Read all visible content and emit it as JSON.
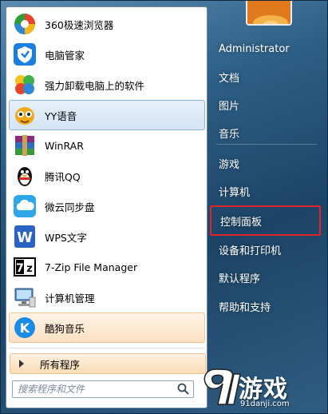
{
  "programs": [
    {
      "label": "360极速浏览器",
      "icon": "360-chrome-icon",
      "state": "normal"
    },
    {
      "label": "电脑管家",
      "icon": "pc-manager-icon",
      "state": "normal"
    },
    {
      "label": "强力卸载电脑上的软件",
      "icon": "uninstall-icon",
      "state": "normal"
    },
    {
      "label": "YY语音",
      "icon": "yy-voice-icon",
      "state": "hover"
    },
    {
      "label": "WinRAR",
      "icon": "winrar-icon",
      "state": "normal"
    },
    {
      "label": "腾讯QQ",
      "icon": "qq-penguin-icon",
      "state": "normal"
    },
    {
      "label": "微云同步盘",
      "icon": "weiyun-cloud-icon",
      "state": "normal"
    },
    {
      "label": "WPS文字",
      "icon": "wps-writer-icon",
      "state": "normal"
    },
    {
      "label": "7-Zip File Manager",
      "icon": "7zip-icon",
      "state": "normal"
    },
    {
      "label": "计算机管理",
      "icon": "computer-management-icon",
      "state": "normal"
    },
    {
      "label": "酷狗音乐",
      "icon": "kugou-icon",
      "state": "hover-orange"
    }
  ],
  "all_programs_label": "所有程序",
  "search": {
    "placeholder": "搜索程序和文件",
    "value": ""
  },
  "right_links": [
    {
      "label": "Administrator",
      "highlight": false
    },
    {
      "label": "文档",
      "highlight": false
    },
    {
      "label": "图片",
      "highlight": false
    },
    {
      "label": "音乐",
      "highlight": false
    },
    {
      "label": "游戏",
      "highlight": false
    },
    {
      "label": "计算机",
      "highlight": false
    },
    {
      "label": "控制面板",
      "highlight": true
    },
    {
      "label": "设备和打印机",
      "highlight": false
    },
    {
      "label": "默认程序",
      "highlight": false
    },
    {
      "label": "帮助和支持",
      "highlight": false
    }
  ],
  "watermark": {
    "brand": "游戏",
    "url": "91danji.com"
  },
  "colors": {
    "highlight_border": "#e0242a",
    "menu_glass": "#2d5e85"
  }
}
